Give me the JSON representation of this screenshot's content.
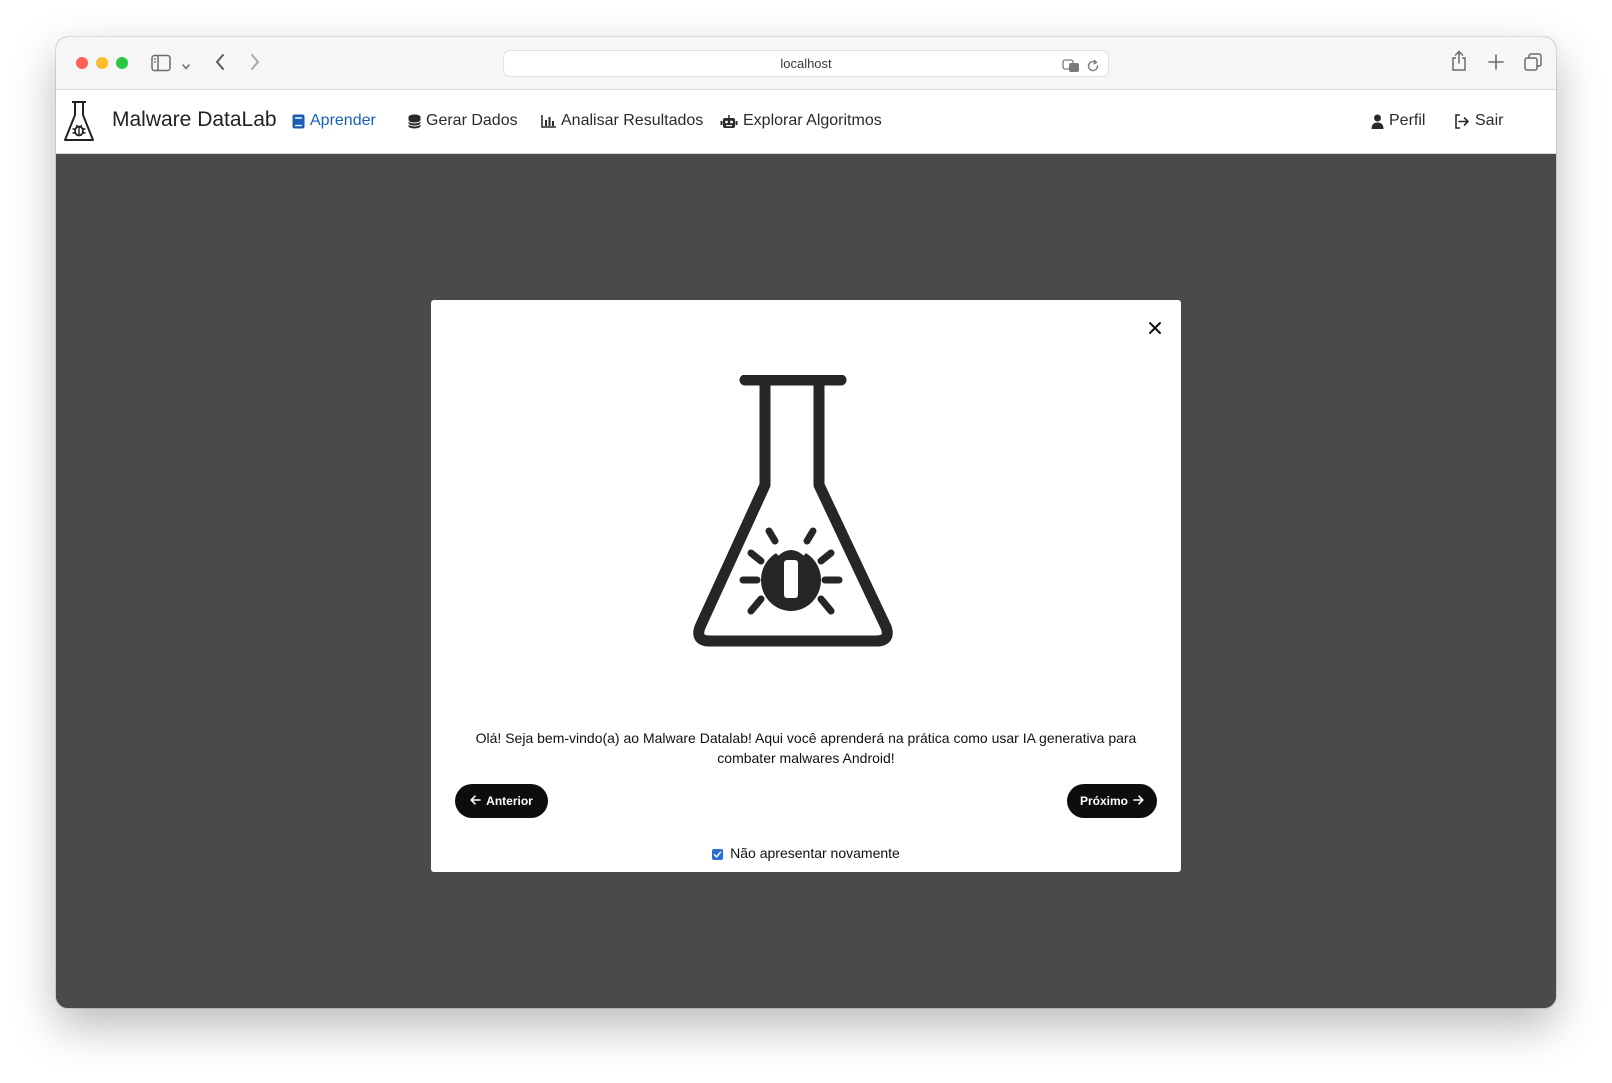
{
  "browser": {
    "url": "localhost"
  },
  "app": {
    "brand": "Malware DataLab"
  },
  "nav": {
    "items": [
      {
        "label": "Aprender",
        "icon": "book-icon",
        "active": true
      },
      {
        "label": "Gerar Dados",
        "icon": "database-icon",
        "active": false
      },
      {
        "label": "Analisar Resultados",
        "icon": "bar-chart-icon",
        "active": false
      },
      {
        "label": "Explorar Algoritmos",
        "icon": "robot-icon",
        "active": false
      }
    ],
    "right": [
      {
        "label": "Perfil",
        "icon": "user-icon"
      },
      {
        "label": "Sair",
        "icon": "sign-out-icon"
      }
    ]
  },
  "modal": {
    "hero_icon": "flask-bug-icon",
    "message": "Olá! Seja bem-vindo(a) ao Malware Datalab! Aqui você aprenderá na prática como usar IA generativa para combater malwares Android!",
    "prev_label": "Anterior",
    "next_label": "Próximo",
    "dont_show_label": "Não apresentar novamente",
    "dont_show_checked": true
  },
  "colors": {
    "active_nav": "#1a5fb4",
    "overlay": "#4a4a4a",
    "button": "#0d0d0d",
    "checkbox": "#2f6fd0"
  }
}
